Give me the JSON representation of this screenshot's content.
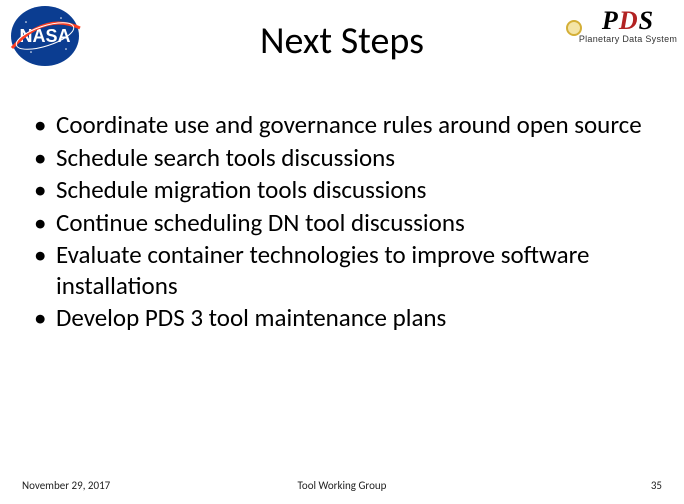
{
  "header": {
    "title": "Next Steps",
    "nasa_alt": "NASA",
    "pds": {
      "letters": {
        "p": "P",
        "d": "D",
        "s": "S"
      },
      "subtitle": "Planetary Data System"
    }
  },
  "bullets": [
    "Coordinate use and governance rules around open source",
    "Schedule search tools discussions",
    "Schedule migration tools discussions",
    "Continue scheduling DN tool discussions",
    "Evaluate container technologies to improve software installations",
    "Develop PDS 3 tool maintenance plans"
  ],
  "footer": {
    "date": "November 29, 2017",
    "center": "Tool Working Group",
    "page": "35"
  }
}
